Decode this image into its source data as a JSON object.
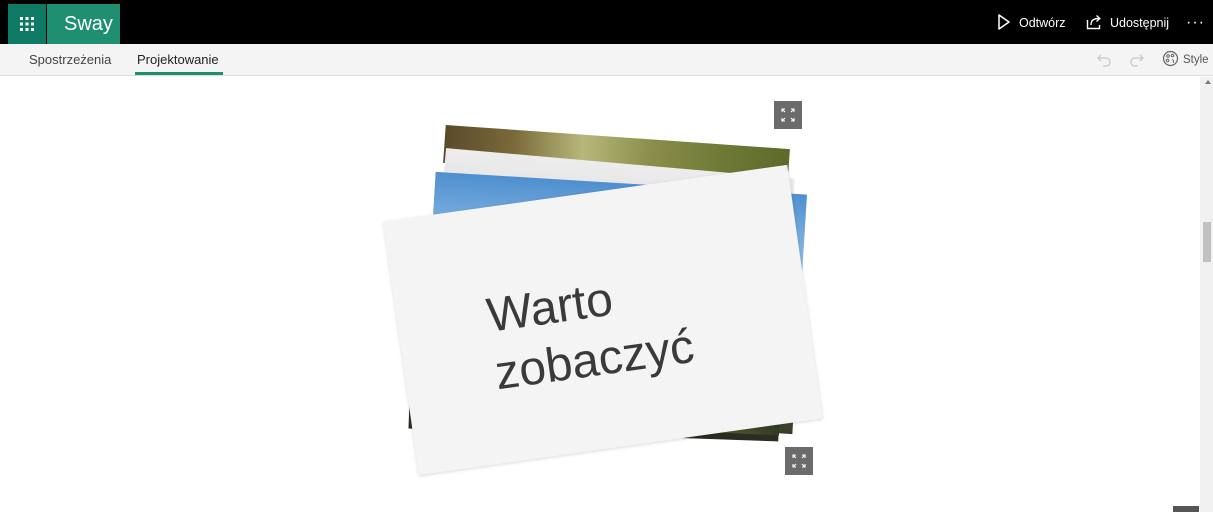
{
  "app": {
    "name": "Sway"
  },
  "header": {
    "play_label": "Odtwórz",
    "share_label": "Udostępnij",
    "more_label": "···"
  },
  "tabs": [
    {
      "label": "Spostrzeżenia",
      "active": false
    },
    {
      "label": "Projektowanie",
      "active": true
    }
  ],
  "toolbar": {
    "styles_label": "Style"
  },
  "content": {
    "title_line1": "Warto",
    "title_line2": "zobaczyć"
  },
  "colors": {
    "accent": "#1f8f72",
    "waffle_bg": "#0e7a63",
    "topbar_bg": "#000000"
  },
  "icons": {
    "app_launcher": "waffle-icon",
    "play": "play-icon",
    "share": "share-icon",
    "undo": "undo-icon",
    "redo": "redo-icon",
    "styles": "palette-icon",
    "expand": "expand-icon"
  }
}
